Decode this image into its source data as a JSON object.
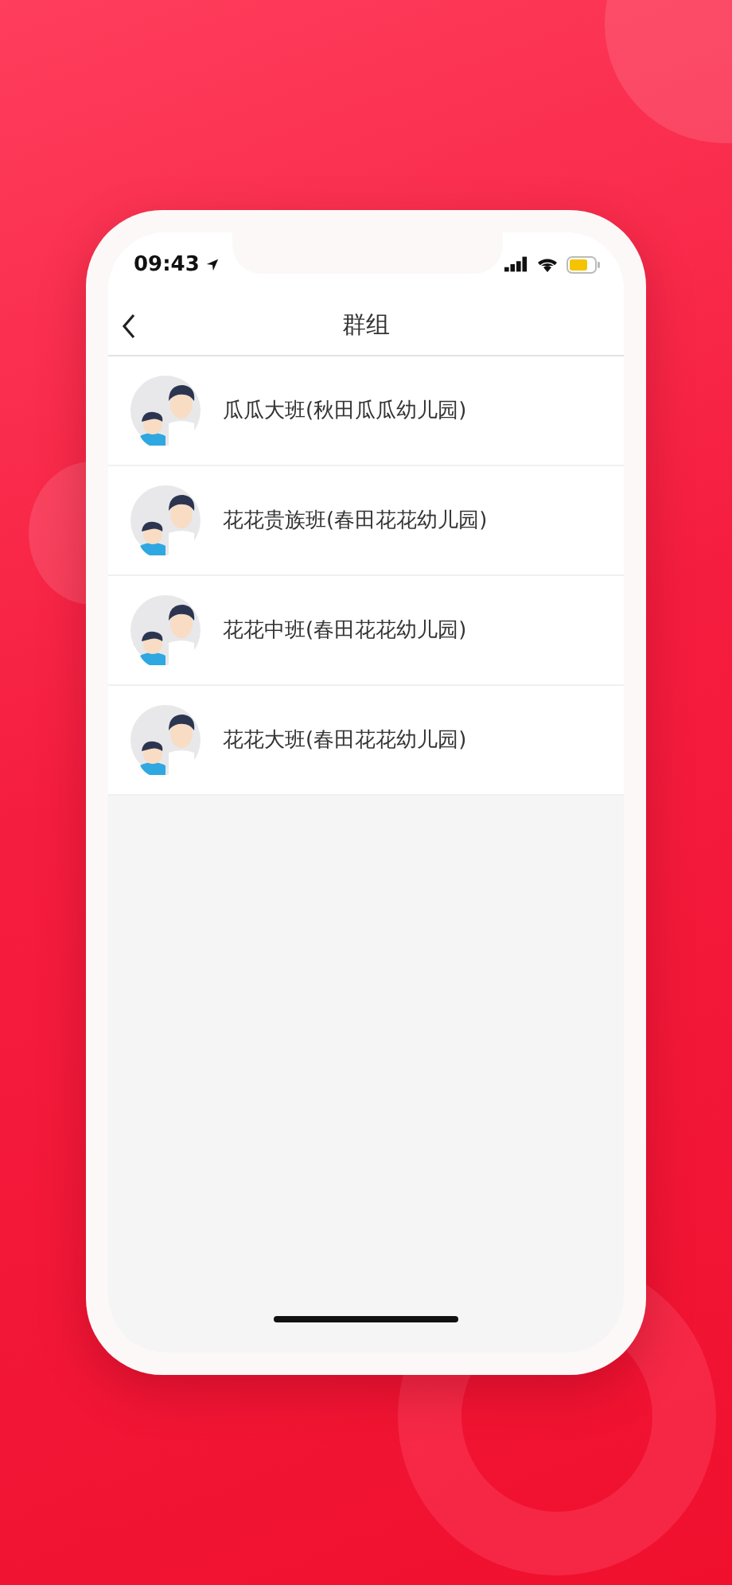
{
  "status_bar": {
    "time": "09:43"
  },
  "nav_bar": {
    "title": "群组"
  },
  "groups": [
    {
      "name": "瓜瓜大班(秋田瓜瓜幼儿园)"
    },
    {
      "name": "花花贵族班(春田花花幼儿园)"
    },
    {
      "name": "花花中班(春田花花幼儿园)"
    },
    {
      "name": "花花大班(春田花花幼儿园)"
    }
  ]
}
